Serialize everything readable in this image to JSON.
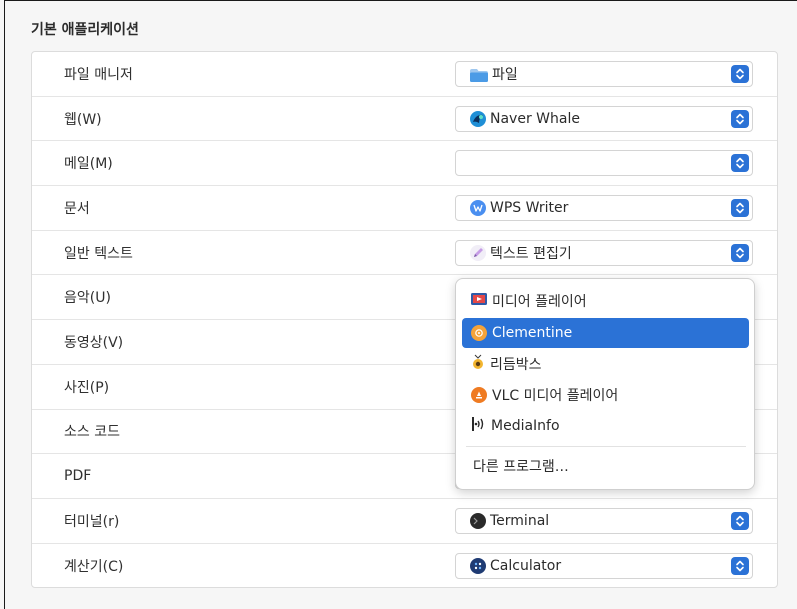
{
  "section": {
    "title": "기본 애플리케이션"
  },
  "rows": [
    {
      "label": "파일 매니저",
      "value": "파일",
      "icon": "folder-icon"
    },
    {
      "label": "웹(W)",
      "value": "Naver Whale",
      "icon": "whale-icon"
    },
    {
      "label": "메일(M)",
      "value": "",
      "icon": ""
    },
    {
      "label": "문서",
      "value": "WPS Writer",
      "icon": "wps-writer-icon"
    },
    {
      "label": "일반 텍스트",
      "value": "텍스트 편집기",
      "icon": "text-editor-icon"
    },
    {
      "label": "음악(U)",
      "value": "",
      "icon": ""
    },
    {
      "label": "동영상(V)",
      "value": "",
      "icon": ""
    },
    {
      "label": "사진(P)",
      "value": "",
      "icon": ""
    },
    {
      "label": "소스 코드",
      "value": "",
      "icon": ""
    },
    {
      "label": "PDF",
      "value": "",
      "icon": ""
    },
    {
      "label": "터미널(r)",
      "value": "Terminal",
      "icon": "terminal-icon"
    },
    {
      "label": "계산기(C)",
      "value": "Calculator",
      "icon": "calculator-icon"
    }
  ],
  "dropdown": {
    "items": [
      {
        "label": "미디어 플레이어",
        "icon": "media-player-icon",
        "selected": false
      },
      {
        "label": "Clementine",
        "icon": "clementine-icon",
        "selected": true
      },
      {
        "label": "리듬박스",
        "icon": "rhythmbox-icon",
        "selected": false
      },
      {
        "label": "VLC 미디어 플레이어",
        "icon": "vlc-icon",
        "selected": false
      },
      {
        "label": "MediaInfo",
        "icon": "mediainfo-icon",
        "selected": false
      }
    ],
    "other_label": "다른 프로그램…"
  },
  "colors": {
    "accent": "#2b72d6",
    "background": "#f6f6f6",
    "card": "#ffffff"
  }
}
